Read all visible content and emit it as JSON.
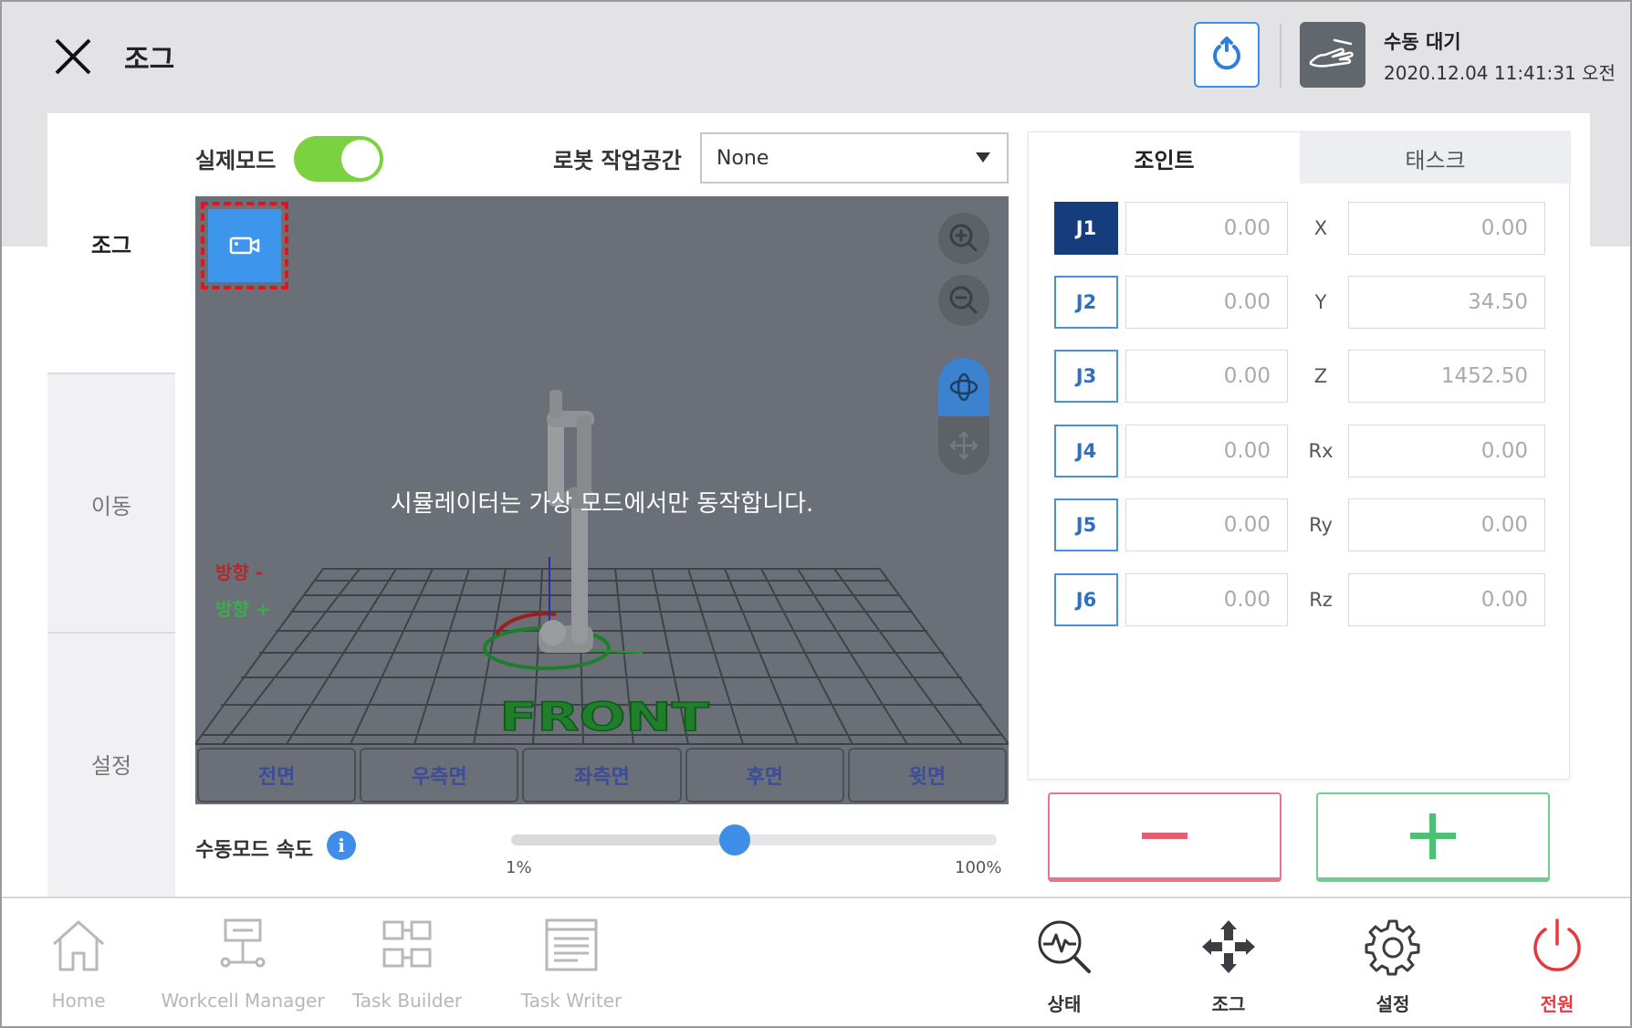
{
  "header": {
    "title": "조그",
    "status_title": "수동 대기",
    "status_time": "2020.12.04 11:41:31 오전"
  },
  "sidebar": {
    "items": [
      {
        "label": "조그"
      },
      {
        "label": "이동"
      },
      {
        "label": "설정"
      }
    ]
  },
  "controls": {
    "real_mode_label": "실제모드",
    "real_mode_on": true,
    "workspace_label": "로봇 작업공간",
    "workspace_value": "None"
  },
  "simulator": {
    "message": "시뮬레이터는 가상 모드에서만 동작합니다.",
    "direction_minus": "방향 -",
    "direction_plus": "방향 +",
    "floor_label": "FRONT",
    "views": [
      {
        "label": "전면"
      },
      {
        "label": "우측면"
      },
      {
        "label": "좌측면"
      },
      {
        "label": "후면"
      },
      {
        "label": "윗면"
      }
    ]
  },
  "speed": {
    "label": "수동모드 속도",
    "info_glyph": "i",
    "min_label": "1%",
    "max_label": "100%",
    "value_fraction": 0.46
  },
  "panel": {
    "tabs": [
      {
        "label": "조인트"
      },
      {
        "label": "태스크"
      }
    ],
    "joints": [
      {
        "label": "J1",
        "value": "0.00"
      },
      {
        "label": "J2",
        "value": "0.00"
      },
      {
        "label": "J3",
        "value": "0.00"
      },
      {
        "label": "J4",
        "value": "0.00"
      },
      {
        "label": "J5",
        "value": "0.00"
      },
      {
        "label": "J6",
        "value": "0.00"
      }
    ],
    "task": [
      {
        "label": "X",
        "value": "0.00"
      },
      {
        "label": "Y",
        "value": "34.50"
      },
      {
        "label": "Z",
        "value": "1452.50"
      },
      {
        "label": "Rx",
        "value": "0.00"
      },
      {
        "label": "Ry",
        "value": "0.00"
      },
      {
        "label": "Rz",
        "value": "0.00"
      }
    ]
  },
  "bottom_nav": {
    "items": [
      {
        "label": "Home",
        "icon": "home-icon"
      },
      {
        "label": "Workcell Manager",
        "icon": "workcell-icon"
      },
      {
        "label": "Task Builder",
        "icon": "task-builder-icon"
      },
      {
        "label": "Task Writer",
        "icon": "task-writer-icon"
      },
      {
        "label": "상태",
        "icon": "status-icon"
      },
      {
        "label": "조그",
        "icon": "jog-icon"
      },
      {
        "label": "설정",
        "icon": "settings-icon"
      },
      {
        "label": "전원",
        "icon": "power-icon"
      }
    ]
  },
  "colors": {
    "accent": "#3e8ee8",
    "active_joint": "#153c7c",
    "toggle_on": "#7bd241",
    "minus": "#e6768a",
    "plus": "#6fcf8e",
    "power": "#e5383f"
  }
}
